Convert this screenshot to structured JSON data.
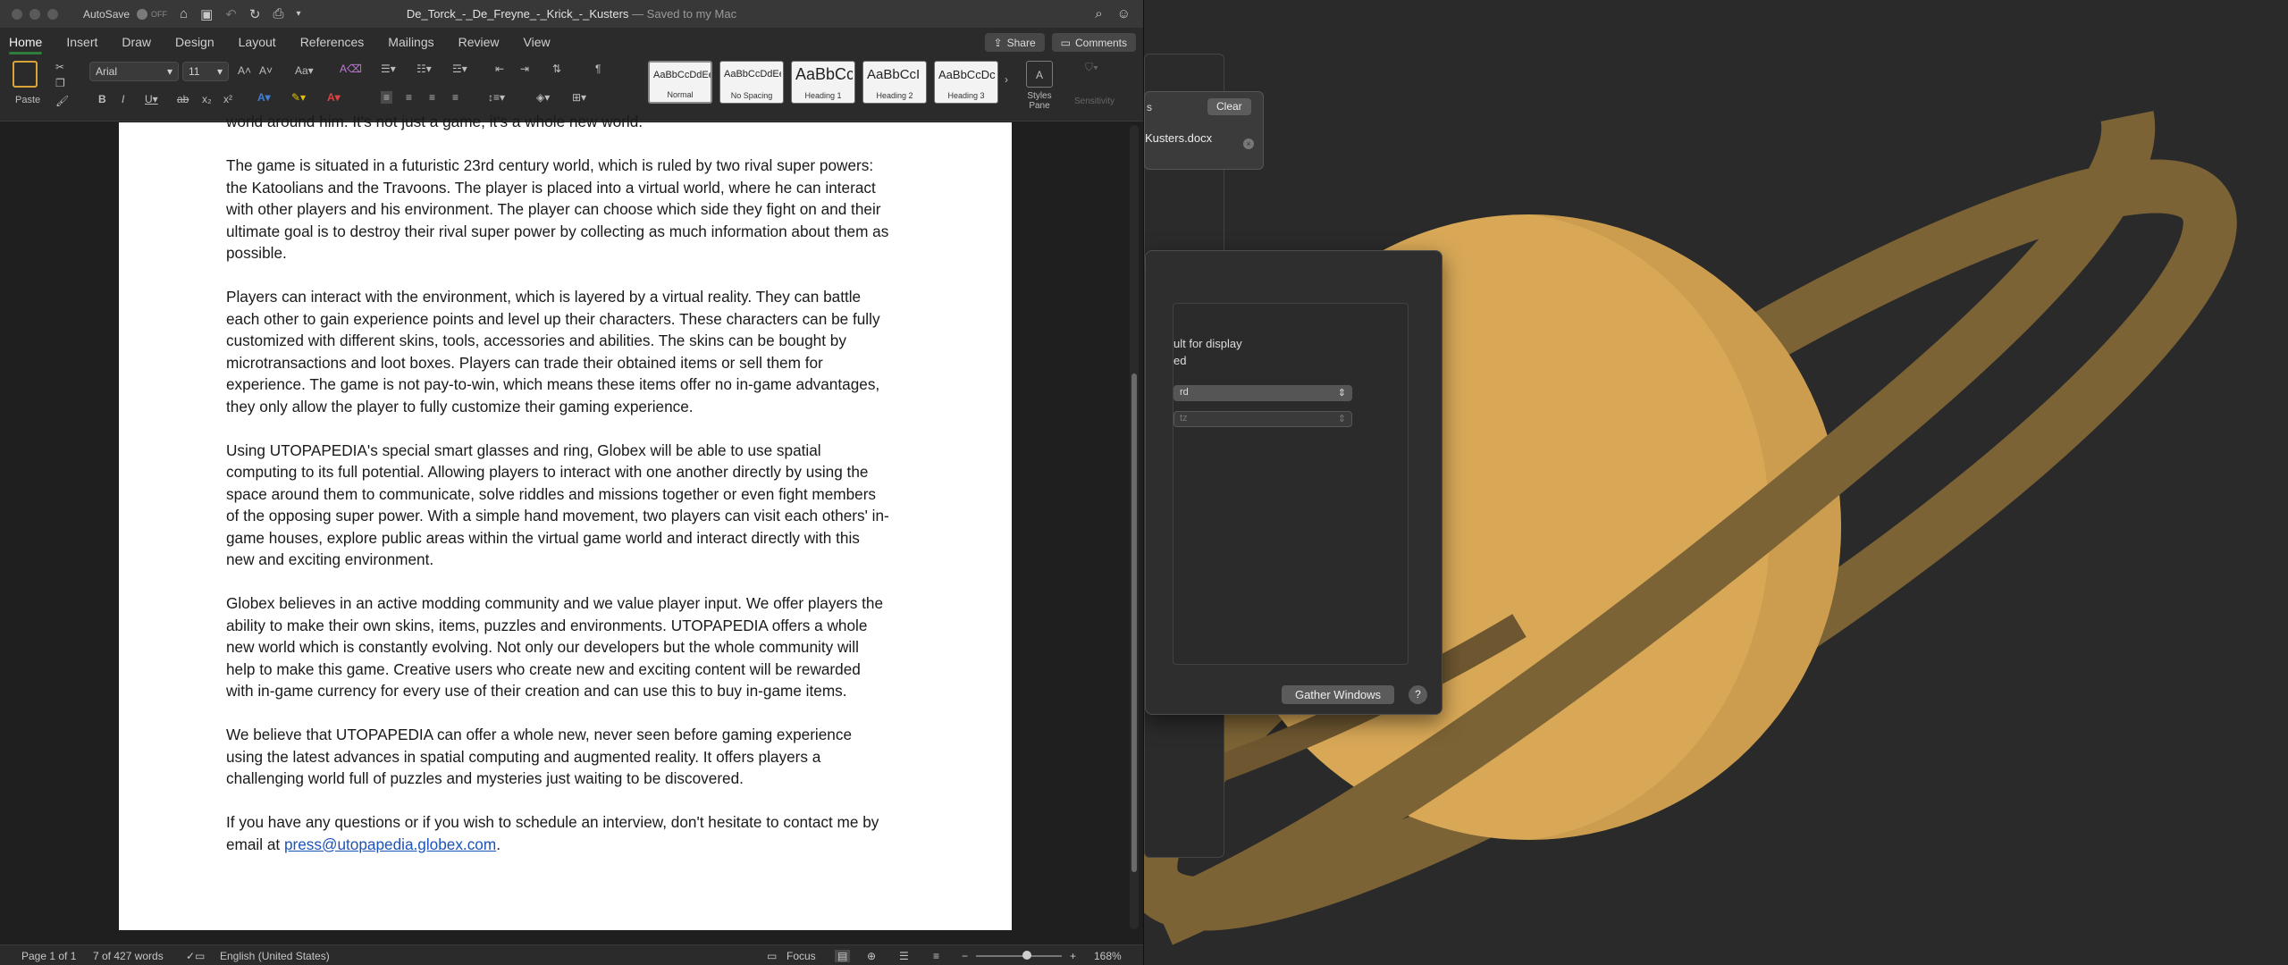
{
  "window": {
    "autosave_label": "AutoSave",
    "autosave_state": "OFF",
    "doc_title": "De_Torck_-_De_Freyne_-_Krick_-_Kusters",
    "doc_status": "— Saved to my Mac"
  },
  "tabs": [
    {
      "label": "Home"
    },
    {
      "label": "Insert"
    },
    {
      "label": "Draw"
    },
    {
      "label": "Design"
    },
    {
      "label": "Layout"
    },
    {
      "label": "References"
    },
    {
      "label": "Mailings"
    },
    {
      "label": "Review"
    },
    {
      "label": "View"
    }
  ],
  "actions": {
    "share": "Share",
    "comments": "Comments"
  },
  "ribbon": {
    "paste": "Paste",
    "font_name": "Arial",
    "font_size": "11",
    "styles": [
      {
        "sample": "AaBbCcDdEe",
        "name": "Normal"
      },
      {
        "sample": "AaBbCcDdEe",
        "name": "No Spacing"
      },
      {
        "sample": "AaBbCc",
        "name": "Heading 1"
      },
      {
        "sample": "AaBbCcI",
        "name": "Heading 2"
      },
      {
        "sample": "AaBbCcDc",
        "name": "Heading 3"
      }
    ],
    "styles_pane": "Styles\nPane",
    "sensitivity": "Sensitivity"
  },
  "document": {
    "cut_line": "world around him. It's not just a game, it's a whole new world.",
    "paragraphs": [
      "The game is situated in a futuristic 23rd century world, which is ruled by two rival super powers: the Katoolians and the Travoons. The player is placed into a virtual world, where he can interact with other players and his environment. The player can choose which side they fight on and their ultimate goal is to destroy their rival super power by collecting as much information about them as possible.",
      "Players can interact with the environment, which is layered by a virtual reality. They can battle each other to gain experience points and level up their characters. These characters can be fully customized with different skins, tools, accessories and abilities. The skins can be bought by microtransactions and loot boxes. Players can trade their obtained items or sell them for experience. The game is not pay-to-win, which means these items offer no in-game advantages, they only allow the player to fully customize their gaming experience.",
      "Using UTOPAPEDIA's special smart glasses and ring, Globex will be able to use spatial computing to its full potential. Allowing players to interact with one another directly by using the space around them to communicate, solve riddles and missions together or even fight members of the opposing super power. With a simple hand movement, two players can visit each others' in-game houses, explore public areas within the virtual game world and interact directly with this new and exciting environment.",
      "Globex believes in an active modding community and we value player input. We offer players the ability to make their own skins, items, puzzles and environments. UTOPAPEDIA offers a whole new world which is constantly evolving. Not only our developers but the whole community will help to make this game. Creative users who create new and exciting content will be rewarded with in-game currency for every use of their creation and can use this to buy in-game items.",
      "We believe that UTOPAPEDIA can offer a whole new, never seen before gaming experience using the latest advances in spatial computing and augmented reality. It offers players a challenging world full of puzzles and mysteries just waiting to be discovered."
    ],
    "last_paragraph_text": "If you have any questions or if you wish to schedule an interview, don't hesitate to contact me by email at ",
    "email": "press@utopapedia.globex.com",
    "last_paragraph_end": "."
  },
  "status": {
    "page": "Page 1 of 1",
    "words": "7 of 427 words",
    "language": "English (United States)",
    "focus": "Focus",
    "zoom": "168%"
  },
  "bg_panels": {
    "clear": "Clear",
    "file": "Kusters.docx",
    "trunc_s": "s",
    "opt1": "ult for display",
    "opt2": "ed",
    "popup1": "rd",
    "popup2": "tz",
    "gather": "Gather Windows",
    "help": "?"
  }
}
